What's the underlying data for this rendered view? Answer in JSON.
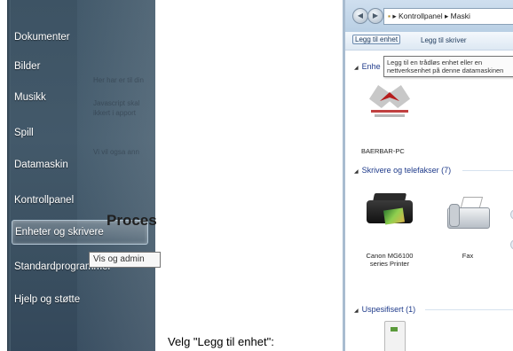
{
  "start_menu": {
    "items": [
      {
        "label": "Dokumenter"
      },
      {
        "label": "Bilder"
      },
      {
        "label": "Musikk"
      },
      {
        "label": "Spill"
      },
      {
        "label": "Datamaskin"
      },
      {
        "label": "Kontrollpanel"
      },
      {
        "label": "Enheter og skrivere",
        "highlighted": true
      },
      {
        "label": "Standardprogrammer"
      },
      {
        "label": "Hjelp og støtte"
      }
    ],
    "tooltip": "Vis og admin",
    "background_heading": "Proces",
    "ghost_text": [
      "Her har er til din",
      "Javascript skal",
      "ikkert i apport",
      "Vi vil ogsa ann"
    ]
  },
  "caption": "Velg \"Legg til enhet\":",
  "explorer": {
    "address": [
      "Kontrollpanel",
      "Maski"
    ],
    "toolbar": {
      "add_device": "Legg til enhet",
      "add_printer": "Legg til skriver"
    },
    "tooltip": "Legg til en trådløs enhet eller en nettverksenhet på denne datamaskinen",
    "groups": {
      "devices": "Enhe",
      "printers": "Skrivere og telefakser (7)",
      "unspecified": "Uspesifisert (1)"
    },
    "devices": {
      "computer": "BAERBAR-PC",
      "printer": "Canon MG6100 series Printer",
      "fax": "Fax"
    }
  },
  "colors": {
    "start_menu_bg": "#43596a",
    "group_header": "#1e3a8a",
    "window_frame": "#b9cfe4"
  }
}
